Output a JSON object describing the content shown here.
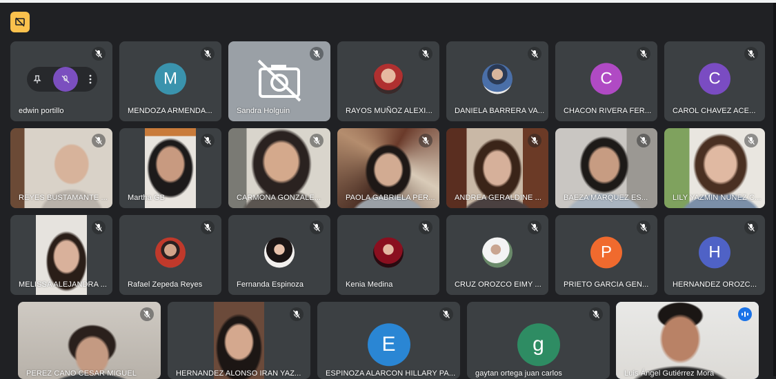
{
  "colors": {
    "background": "#202124",
    "tile": "#3c4043",
    "accent_yellow": "#fbc14d",
    "active_outline": "#8ab4f8",
    "speaking_blue": "#1a73e8"
  },
  "participants": [
    {
      "name": "edwin portillo",
      "kind": "hover"
    },
    {
      "name": "MENDOZA ARMENDA...",
      "kind": "avatar",
      "letter": "M",
      "color": "#3a93ad"
    },
    {
      "name": "Sandra Holguin",
      "kind": "camoff"
    },
    {
      "name": "RAYOS MUÑOZ ALEXI...",
      "kind": "photo"
    },
    {
      "name": "DANIELA BARRERA VA...",
      "kind": "photo"
    },
    {
      "name": "CHACON RIVERA FER...",
      "kind": "avatar",
      "letter": "C",
      "color": "#b04ac4"
    },
    {
      "name": "CAROL CHAVEZ ACE...",
      "kind": "avatar",
      "letter": "C",
      "color": "#7a4cc2"
    },
    {
      "name": "REYES BUSTAMANTE ...",
      "kind": "video"
    },
    {
      "name": "Martha GB",
      "kind": "video"
    },
    {
      "name": "CARMONA GONZALE...",
      "kind": "video"
    },
    {
      "name": "PAOLA GABRIELA PER...",
      "kind": "video"
    },
    {
      "name": "ANDREA GERALDINE ...",
      "kind": "video"
    },
    {
      "name": "BAEZA MARQUEZ ES...",
      "kind": "video"
    },
    {
      "name": "LILY YAZMIN NUNEZ C...",
      "kind": "video"
    },
    {
      "name": "MELISSA ALEJANDRA ...",
      "kind": "video"
    },
    {
      "name": "Rafael Zepeda Reyes",
      "kind": "photo"
    },
    {
      "name": "Fernanda Espinoza",
      "kind": "photo"
    },
    {
      "name": "Kenia Medina",
      "kind": "photo"
    },
    {
      "name": "CRUZ OROZCO EIMY ...",
      "kind": "photo"
    },
    {
      "name": "PRIETO GARCIA GEN...",
      "kind": "avatar",
      "letter": "P",
      "color": "#f06a2e"
    },
    {
      "name": "HERNANDEZ OROZC...",
      "kind": "avatar",
      "letter": "H",
      "color": "#4f62c6"
    },
    {
      "name": "PEREZ CANO CESAR MIGUEL",
      "kind": "video"
    },
    {
      "name": "HERNANDEZ ALONSO IRAN YAZ...",
      "kind": "video"
    },
    {
      "name": "ESPINOZA ALARCON HILLARY PA...",
      "kind": "avatar",
      "letter": "E",
      "color": "#2a86d4"
    },
    {
      "name": "gaytan ortega juan carlos",
      "kind": "avatar",
      "letter": "g",
      "color": "#2e8c63"
    },
    {
      "name": "Luis Ángel Gutiérrez Mora",
      "kind": "video",
      "speaking": true
    }
  ]
}
